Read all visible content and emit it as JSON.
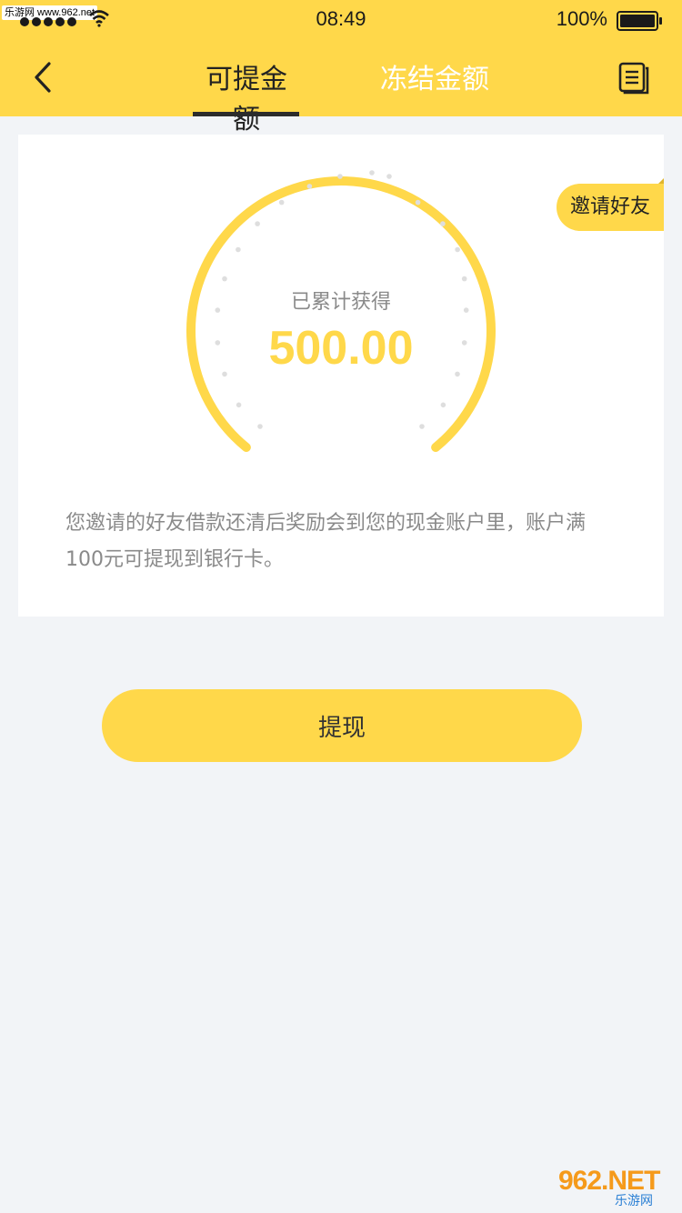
{
  "status_bar": {
    "watermark": "乐游网 www.962.net",
    "time": "08:49",
    "battery": "100%"
  },
  "header": {
    "tabs": [
      {
        "label": "可提金额",
        "active": true
      },
      {
        "label": "冻结金额",
        "active": false
      }
    ],
    "back_icon": "chevron-left-icon",
    "menu_icon": "list-icon"
  },
  "card": {
    "gauge_label": "已累计获得",
    "amount": "500.00",
    "invite_label": "邀请好友",
    "description": "您邀请的好友借款还清后奖励会到您的现金账户里，账户满100元可提现到银行卡。"
  },
  "withdraw_button": "提现",
  "site_logo": {
    "main": "962.NET",
    "sub": "乐游网"
  },
  "colors": {
    "accent": "#ffd84a",
    "background": "#f2f4f7",
    "card": "#ffffff",
    "muted_text": "#8a8a8a"
  }
}
